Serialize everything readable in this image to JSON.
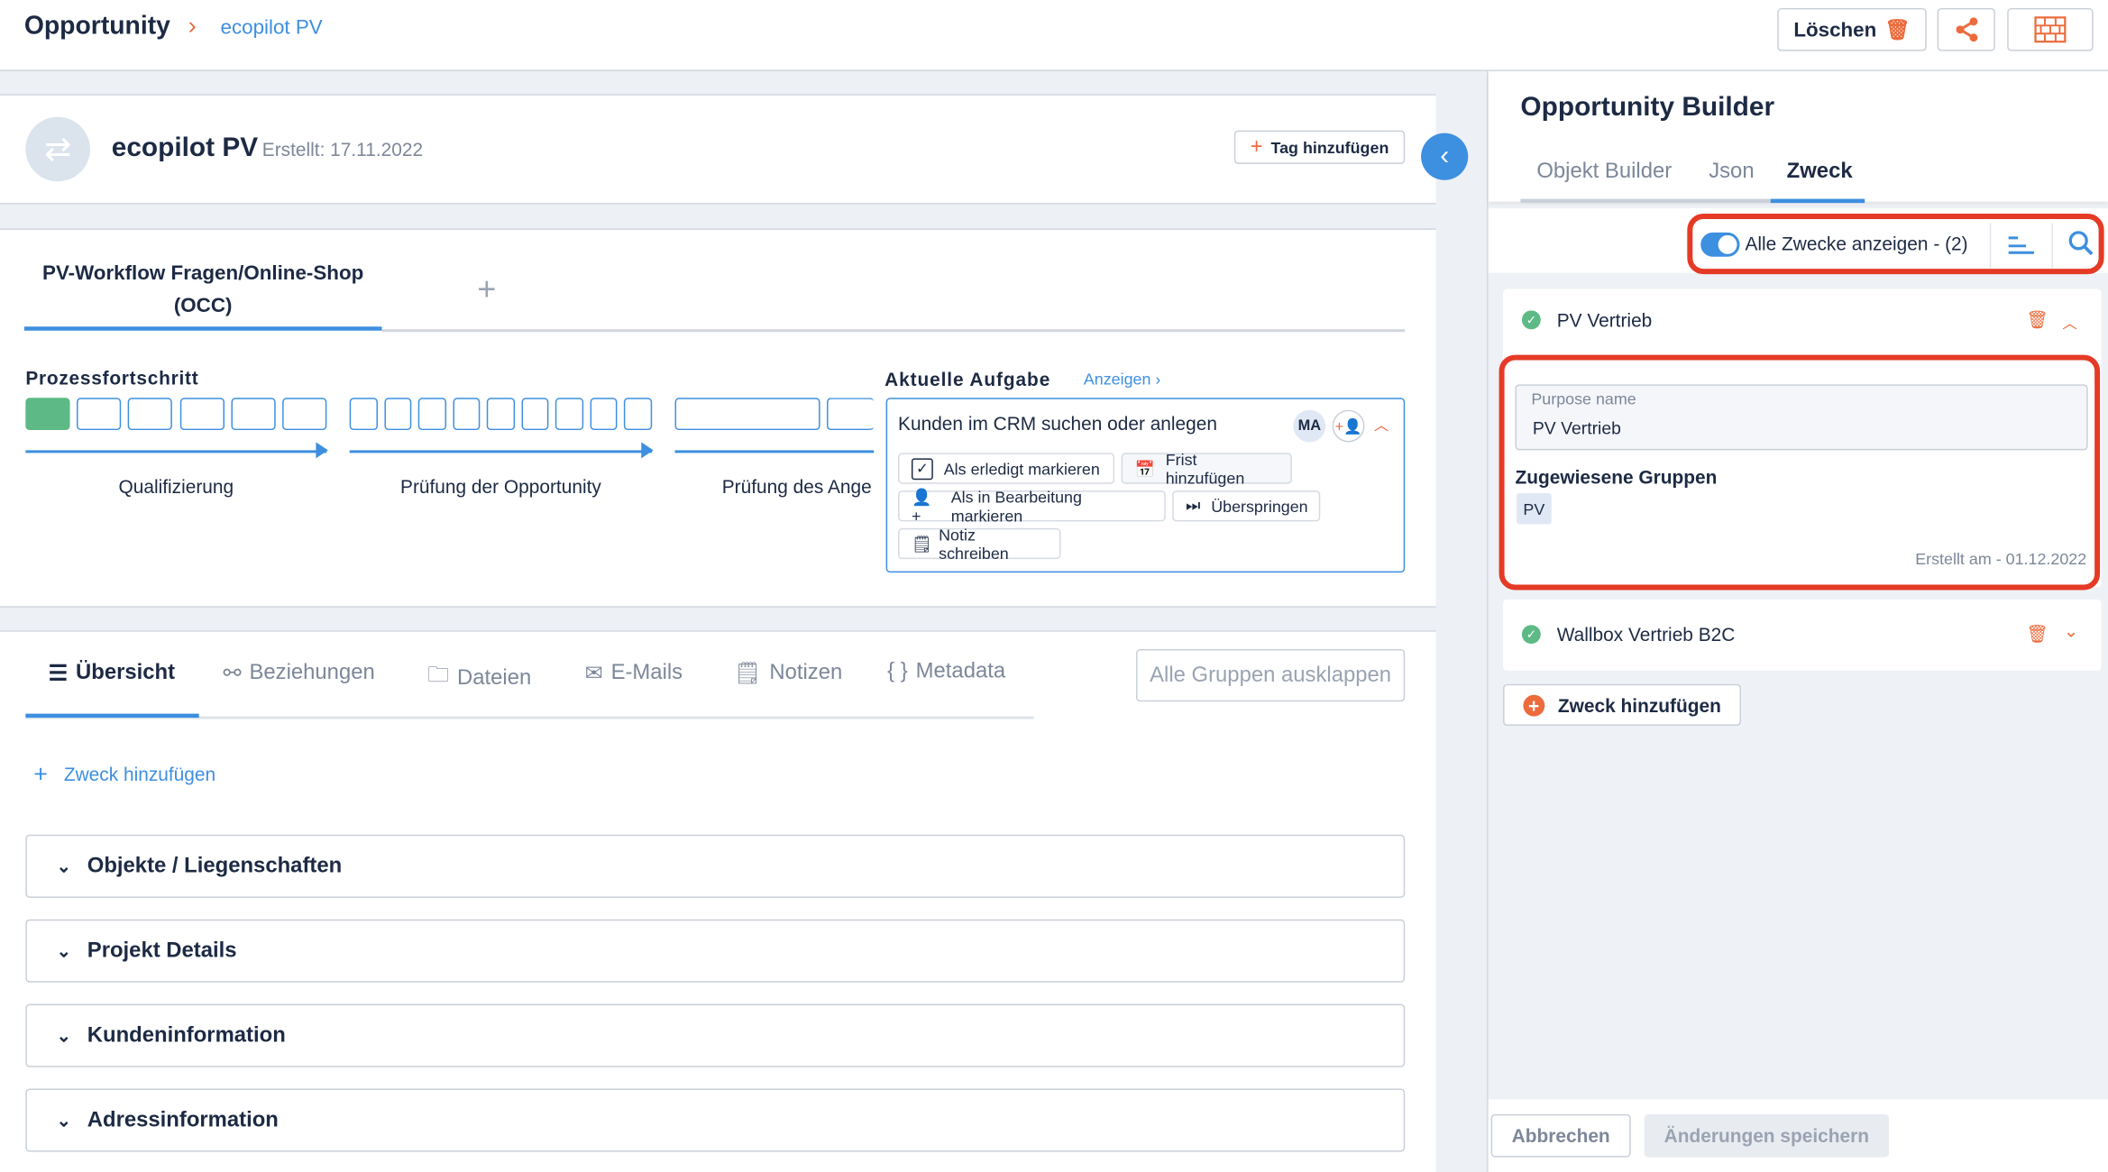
{
  "header": {
    "breadcrumb_root": "Opportunity",
    "breadcrumb_current": "ecopilot PV",
    "delete_label": "Löschen"
  },
  "record": {
    "title": "ecopilot PV",
    "created": "Erstellt: 17.11.2022",
    "add_tag_label": "Tag hinzufügen"
  },
  "workflow": {
    "tab_label": "PV-Workflow Fragen/Online-Shop (OCC)",
    "progress_label": "Prozessfortschritt",
    "stages": [
      {
        "label": "Qualifizierung",
        "steps": 6,
        "done": 1
      },
      {
        "label": "Prüfung der Opportunity",
        "steps": 9,
        "done": 0
      },
      {
        "label": "Prüfung des Ange",
        "steps": 2,
        "done": 0
      }
    ]
  },
  "task": {
    "heading": "Aktuelle Aufgabe",
    "show_link": "Anzeigen",
    "title": "Kunden im CRM suchen oder anlegen",
    "assignee": "MA",
    "actions": [
      "Als erledigt markieren",
      "Frist hinzufügen",
      "Als in Bearbeitung markieren",
      "Überspringen",
      "Notiz schreiben"
    ]
  },
  "tabs": {
    "items": [
      "Übersicht",
      "Beziehungen",
      "Dateien",
      "E-Mails",
      "Notizen",
      "Metadata"
    ],
    "active": "Übersicht",
    "expand_all_label": "Alle Gruppen ausklappen"
  },
  "overview": {
    "add_purpose_label": "Zweck hinzufügen",
    "groups": [
      "Objekte / Liegenschaften",
      "Projekt Details",
      "Kundeninformation",
      "Adressinformation"
    ]
  },
  "builder": {
    "title": "Opportunity Builder",
    "tabs": [
      "Objekt Builder",
      "Json",
      "Zweck"
    ],
    "active_tab": "Zweck",
    "toggle_label": "Alle Zwecke anzeigen - (2)",
    "toggle_on": true,
    "purposes": [
      {
        "name": "PV Vertrieb",
        "expanded": true,
        "field_label": "Purpose name",
        "field_value": "PV Vertrieb",
        "groups_heading": "Zugewiesene Gruppen",
        "groups": [
          "PV"
        ],
        "created": "Erstellt am - 01.12.2022"
      },
      {
        "name": "Wallbox Vertrieb B2C",
        "expanded": false
      }
    ],
    "add_purpose_label": "Zweck hinzufügen",
    "cancel_label": "Abbrechen",
    "save_label": "Änderungen speichern"
  },
  "colors": {
    "accent": "#3d8fe0",
    "danger": "#ec6b3d",
    "success": "#5dba86",
    "highlight": "#e53a25"
  }
}
